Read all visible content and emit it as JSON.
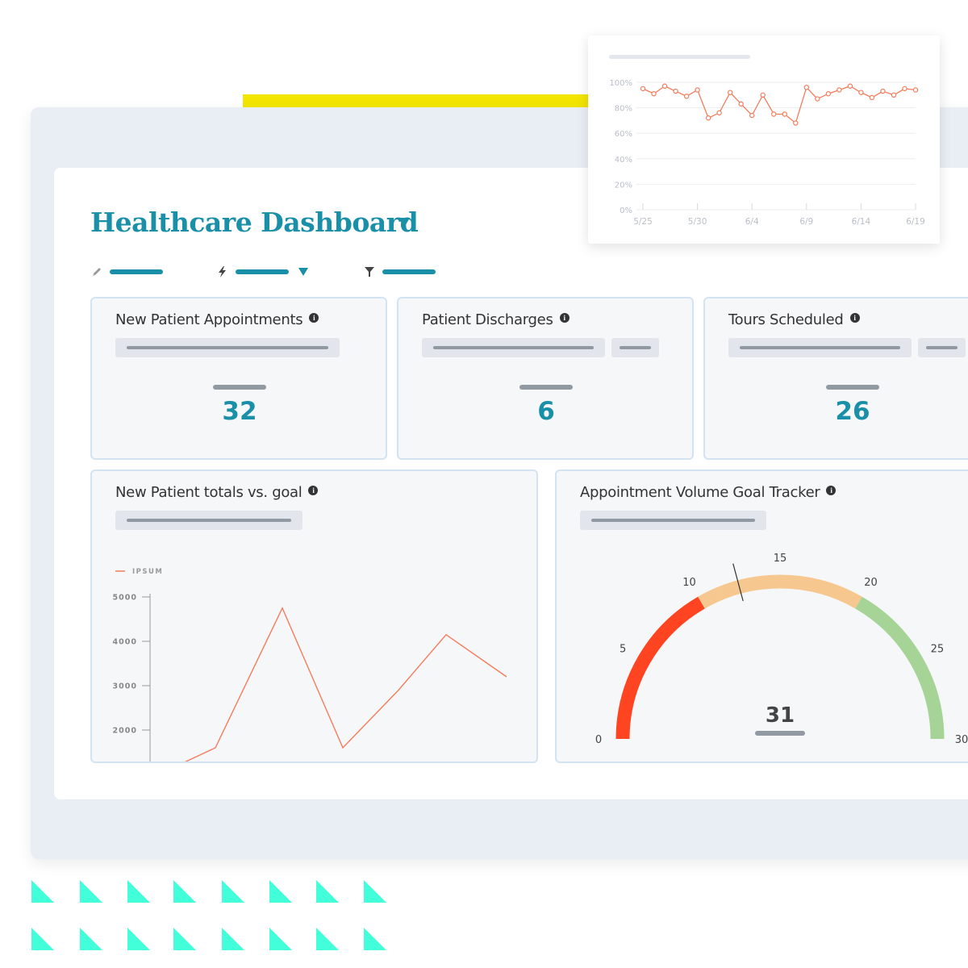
{
  "dashboard": {
    "title": "Healthcare Dashboard",
    "accent_color": "#1a8fa8",
    "toolbar": [
      {
        "icon": "pencil-icon"
      },
      {
        "icon": "lightning-icon",
        "has_dropdown": true
      },
      {
        "icon": "filter-icon"
      }
    ]
  },
  "kpis": [
    {
      "title": "New Patient Appointments",
      "info": "i",
      "value": "32"
    },
    {
      "title": "Patient Discharges",
      "info": "i",
      "value": "6"
    },
    {
      "title": "Tours Scheduled",
      "info": "i",
      "value": "26"
    }
  ],
  "line_card": {
    "title": "New Patient totals vs. goal",
    "info": "i"
  },
  "gauge_card": {
    "title": "Appointment Volume Goal Tracker",
    "info": "i"
  },
  "chart_data": [
    {
      "type": "line",
      "title": "",
      "x_ticks": [
        "5/25",
        "5/30",
        "6/4",
        "6/9",
        "6/14",
        "6/19"
      ],
      "y_ticks": [
        "0%",
        "20%",
        "40%",
        "60%",
        "80%",
        "100%"
      ],
      "ylim": [
        0,
        100
      ],
      "grid": true,
      "color": "#f47c5c",
      "series": [
        {
          "name": "",
          "values": [
            95,
            91,
            97,
            93,
            89,
            94,
            72,
            76,
            92,
            83,
            74,
            90,
            75,
            75,
            68,
            96,
            87,
            91,
            94,
            97,
            92,
            88,
            93,
            90,
            95,
            94
          ]
        }
      ]
    },
    {
      "type": "line",
      "title": "New Patient totals vs. goal",
      "legend": [
        "IPSUM"
      ],
      "legend_position": "top-left",
      "y_ticks": [
        "2000",
        "3000",
        "4000",
        "5000"
      ],
      "ylim": [
        1200,
        5150
      ],
      "color": "#f47c5c",
      "series": [
        {
          "name": "IPSUM",
          "values": [
            1200,
            1600,
            4750,
            1600,
            2900,
            4150,
            3200
          ]
        }
      ]
    },
    {
      "type": "gauge",
      "title": "Appointment Volume Goal Tracker",
      "min": 0,
      "max": 30,
      "ticks": [
        "0",
        "5",
        "10",
        "15",
        "20",
        "25",
        "30"
      ],
      "bands": [
        {
          "from": 0,
          "to": 10,
          "color": "#ff4422"
        },
        {
          "from": 10,
          "to": 20,
          "color": "#f6c88f"
        },
        {
          "from": 20,
          "to": 30,
          "color": "#a6d497"
        }
      ],
      "needle": 12.5,
      "value_label": "31"
    }
  ]
}
